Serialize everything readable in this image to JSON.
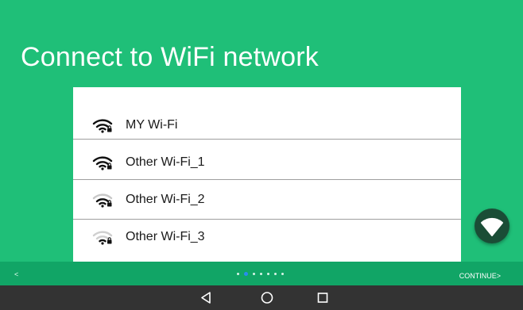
{
  "colors": {
    "background": "#1fbf78",
    "pager_bar": "#11a566",
    "nav_bar": "#333333",
    "card": "#ffffff",
    "fab": "#1a4d36",
    "active_dot": "#2a8bf0"
  },
  "title": "Connect to WiFi network",
  "networks": [
    {
      "name": "MY Wi-Fi",
      "icon": "wifi-full-signal-icon"
    },
    {
      "name": "Other Wi-Fi_1",
      "icon": "wifi-locked-full-signal-icon"
    },
    {
      "name": "Other Wi-Fi_2",
      "icon": "wifi-locked-medium-signal-icon"
    },
    {
      "name": "Other Wi-Fi_3",
      "icon": "wifi-locked-weak-signal-icon"
    }
  ],
  "fab": {
    "icon": "wifi-icon"
  },
  "pager": {
    "prev_label": "<",
    "next_label": "CONTINUE>",
    "total_pages": 7,
    "active_page": 2
  },
  "navigation": {
    "back_icon": "back-triangle-icon",
    "home_icon": "home-circle-icon",
    "recents_icon": "recents-square-icon"
  }
}
